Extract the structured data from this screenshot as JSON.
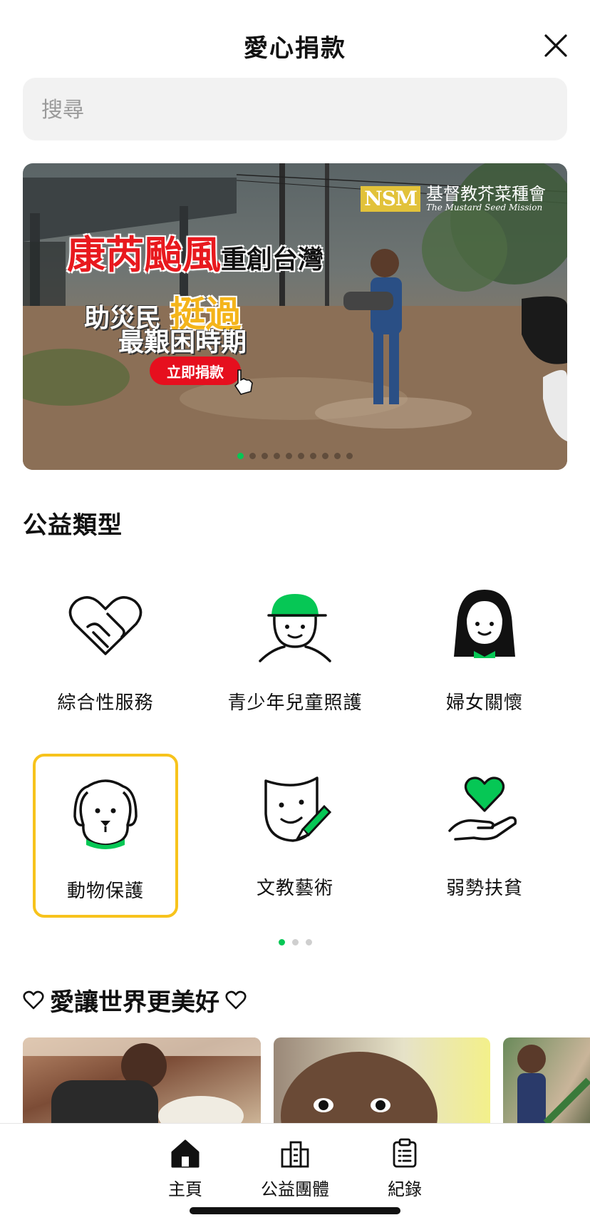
{
  "header": {
    "title": "愛心捐款",
    "close_label": "close"
  },
  "search": {
    "placeholder": "搜尋"
  },
  "banner": {
    "org_mark": "NSM",
    "org_name_cn": "基督教芥菜種會",
    "org_name_en": "The Mustard Seed Mission",
    "headline": "康芮颱風",
    "headline_sub": "重創台灣",
    "line2_prefix": "助災民",
    "line2_highlight": "挺過",
    "line3": "最艱困時期",
    "cta": "立即捐款",
    "slide_count": 10,
    "active_slide": 0
  },
  "categories": {
    "title": "公益類型",
    "items": [
      {
        "label": "綜合性服務",
        "icon": "handshake-heart-icon"
      },
      {
        "label": "青少年兒童照護",
        "icon": "kid-cap-icon"
      },
      {
        "label": "婦女關懷",
        "icon": "woman-icon"
      },
      {
        "label": "動物保護",
        "icon": "dog-icon",
        "selected": true
      },
      {
        "label": "文教藝術",
        "icon": "mask-brush-icon"
      },
      {
        "label": "弱勢扶貧",
        "icon": "hand-heart-icon"
      }
    ],
    "page_count": 3,
    "active_page": 0
  },
  "love": {
    "title": "愛讓世界更美好"
  },
  "tabbar": {
    "items": [
      {
        "label": "主頁",
        "icon": "home-icon",
        "active": true
      },
      {
        "label": "公益團體",
        "icon": "buildings-icon"
      },
      {
        "label": "紀錄",
        "icon": "clipboard-icon"
      }
    ]
  },
  "colors": {
    "accent": "#06c755",
    "selected_border": "#f7c31c",
    "cta_red": "#e60f1e"
  }
}
